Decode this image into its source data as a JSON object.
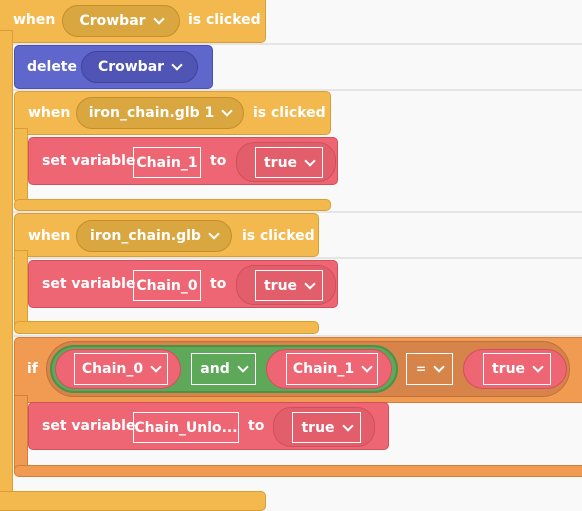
{
  "workspace": {
    "colors": {
      "event": "#f4b94e",
      "action": "#5f66cc",
      "variable": "#ee6673",
      "control": "#f19a51",
      "logic": "#5ea85a",
      "background": "#f9f9f9"
    }
  },
  "blocks": {
    "crowbar_event": {
      "when": "when",
      "target": "Crowbar",
      "suffix": "is clicked"
    },
    "delete_block": {
      "label": "delete",
      "target": "Crowbar"
    },
    "chain1_event": {
      "when": "when",
      "target": "iron_chain.glb 1",
      "suffix": "is clicked",
      "set": {
        "label": "set variable",
        "variable": "Chain_1",
        "to": "to",
        "value": "true"
      }
    },
    "chain0_event": {
      "when": "when",
      "target": "iron_chain.glb",
      "suffix": "is clicked",
      "set": {
        "label": "set variable",
        "variable": "Chain_0",
        "to": "to",
        "value": "true"
      }
    },
    "if_block": {
      "label": "if",
      "left_var": "Chain_0",
      "logic_op": "and",
      "right_var": "Chain_1",
      "compare_op": "=",
      "compare_value": "true",
      "set": {
        "label": "set variable",
        "variable": "Chain_Unlo...",
        "to": "to",
        "value": "true"
      }
    }
  }
}
